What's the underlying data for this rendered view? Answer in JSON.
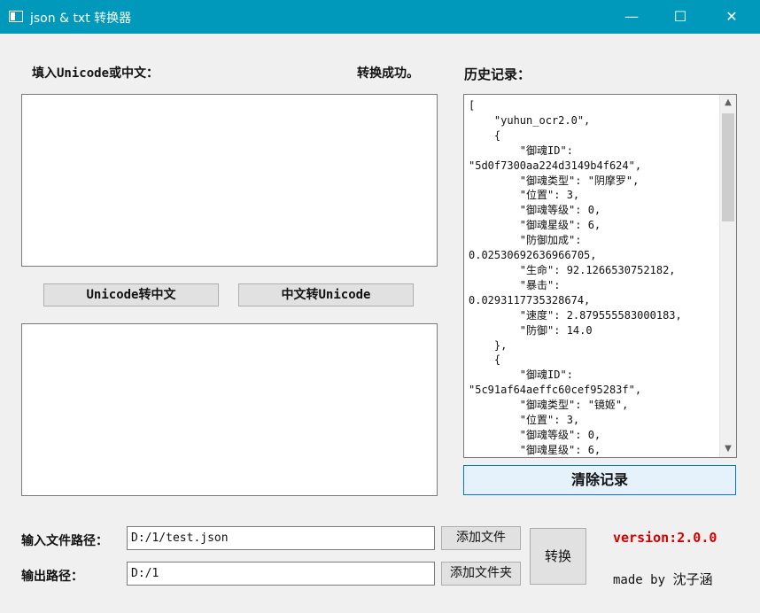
{
  "window": {
    "title": "json & txt 转换器",
    "minimize": "—",
    "maximize": "☐",
    "close": "✕"
  },
  "left": {
    "input_label": "填入Unicode或中文：",
    "status": "转换成功。",
    "input_text": "",
    "output_text": "",
    "btn_unicode_to_cn": "Unicode转中文",
    "btn_cn_to_unicode": "中文转Unicode"
  },
  "history": {
    "label": "历史记录：",
    "text": "[\n    \"yuhun_ocr2.0\",\n    {\n        \"御魂ID\":\n\"5d0f7300aa224d3149b4f624\",\n        \"御魂类型\": \"阴摩罗\",\n        \"位置\": 3,\n        \"御魂等级\": 0,\n        \"御魂星级\": 6,\n        \"防御加成\":\n0.02530692636966705,\n        \"生命\": 92.1266530752182,\n        \"暴击\":\n0.0293117735328674,\n        \"速度\": 2.879555583000183,\n        \"防御\": 14.0\n    },\n    {\n        \"御魂ID\":\n\"5c91af64aeffc60cef95283f\",\n        \"御魂类型\": \"镜姬\",\n        \"位置\": 3,\n        \"御魂等级\": 0,\n        \"御魂星级\": 6,",
    "clear_button": "清除记录",
    "scroll_up": "▲",
    "scroll_down": "▼"
  },
  "file": {
    "input_path_label": "输入文件路径：",
    "input_path_value": "D:/1/test.json",
    "add_file_button": "添加文件",
    "output_path_label": "输出路径：",
    "output_path_value": "D:/1",
    "add_folder_button": "添加文件夹",
    "convert_button": "转换"
  },
  "footer": {
    "version": "version:2.0.0",
    "made_by": "made by",
    "author": "沈子涵"
  },
  "colors": {
    "titlebar": "#0099bc",
    "version": "#d40000",
    "clear_button_bg": "#e5f1fb",
    "clear_button_border": "#0078d7"
  }
}
